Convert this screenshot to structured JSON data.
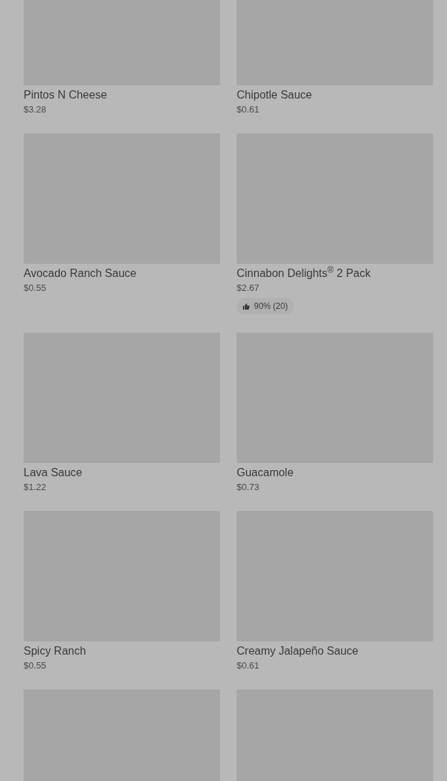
{
  "products": [
    {
      "kind": "product",
      "name": "Pintos N Cheese",
      "price": "$3.28"
    },
    {
      "kind": "product",
      "name": "Chipotle Sauce",
      "price": "$0.61"
    },
    {
      "kind": "product",
      "name": "Avocado Ranch Sauce",
      "price": "$0.55"
    },
    {
      "kind": "product",
      "name": "Cinnabon Delights$^{®}$ 2 Pack",
      "price": "$2.67",
      "rating": "90% (20)"
    },
    {
      "kind": "product",
      "name": "Lava Sauce",
      "price": "$1.22"
    },
    {
      "kind": "product",
      "name": "Guacamole",
      "price": "$0.73"
    },
    {
      "kind": "product",
      "name": "Spicy Ranch",
      "price": "$0.55"
    },
    {
      "kind": "product",
      "name": "Creamy Jalapeño Sauce",
      "price": "$0.61"
    },
    {
      "kind": "image_only"
    },
    {
      "kind": "image_only"
    }
  ]
}
